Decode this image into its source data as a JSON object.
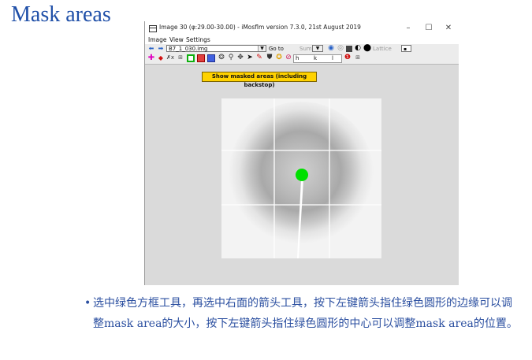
{
  "slide": {
    "title": "Mask areas",
    "bullet": "选中绿色方框工具，再选中右面的箭头工具，按下左键箭头指住绿色圆形的边缘可以调整mask area的大小，按下左键箭头指住绿色圆形的中心可以调整mask area的位置。"
  },
  "window": {
    "title": "Image 30 (φ:29.00-30.00) - iMosflm version 7.3.0, 21st August 2019",
    "controls": {
      "minimize": "–",
      "maximize": "☐",
      "close": "✕"
    },
    "menu": [
      "Image",
      "View",
      "Settings"
    ],
    "toolbar1": {
      "file": "B7_1_030.img",
      "goto": "Go to",
      "sum": "Sum",
      "lattice": "Lattice"
    },
    "toolbar2": {
      "h": "h",
      "k": "k",
      "l": "l"
    },
    "tooltip": "Show masked areas (including backstop)"
  },
  "colors": {
    "title": "#1f4fa8",
    "bullet": "#2b4fa0",
    "mask_circle": "#00e000",
    "tooltip_bg": "#ffd200"
  }
}
